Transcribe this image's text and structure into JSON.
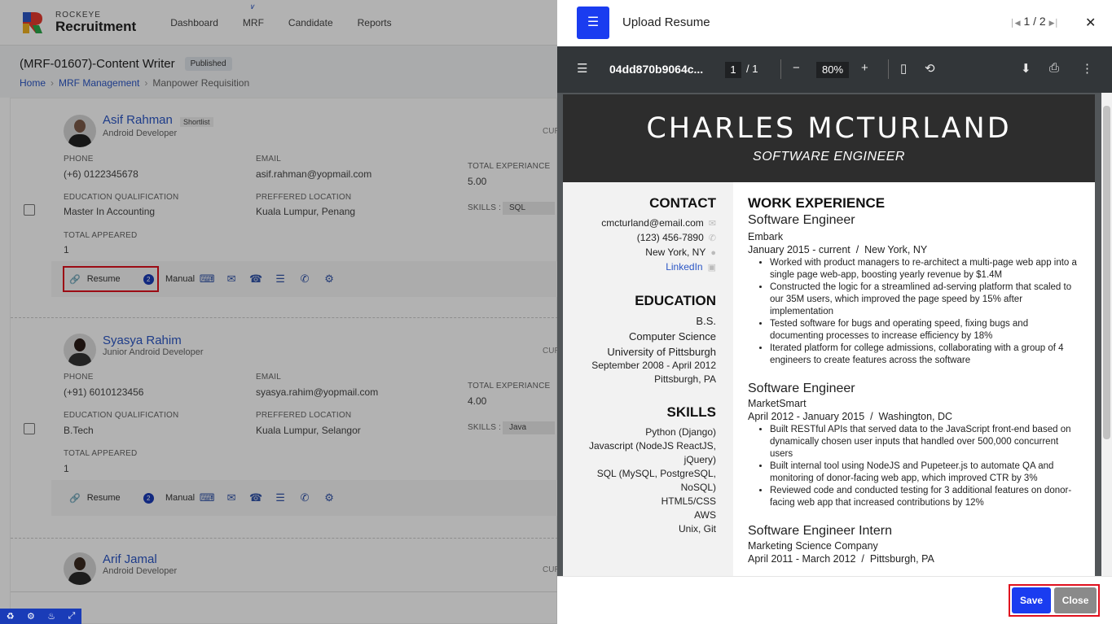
{
  "app": {
    "logo_small": "ROCKEYE",
    "logo_big": "Recruitment",
    "nav": [
      "Dashboard",
      "MRF",
      "Candidate",
      "Reports"
    ],
    "page_title": "(MRF-01607)-Content Writer",
    "status_badge": "Published",
    "breadcrumb": [
      "Home",
      "MRF Management",
      "Manpower Requisition"
    ]
  },
  "labels": {
    "phone": "PHONE",
    "email": "EMAIL",
    "total_exp": "TOTAL EXPERIANCE",
    "education": "EDUCATION QUALIFICATION",
    "location": "PREFFERED LOCATION",
    "skills": "SKILLS :",
    "appeared": "TOTAL APPEARED",
    "cur": "CUR",
    "resume": "Resume",
    "manual": "Manual"
  },
  "candidates": [
    {
      "name": "Asif Rahman",
      "tag": "Shortlist",
      "role": "Android Developer",
      "phone": "(+6) 0122345678",
      "email": "asif.rahman@yopmail.com",
      "experience": "5.00",
      "education": "Master In Accounting",
      "location": "Kuala Lumpur, Penang",
      "skill": "SQL",
      "appeared": "1",
      "resume_count": "2"
    },
    {
      "name": "Syasya Rahim",
      "tag": "",
      "role": "Junior Android Developer",
      "phone": "(+91) 6010123456",
      "email": "syasya.rahim@yopmail.com",
      "experience": "4.00",
      "education": "B.Tech",
      "location": "Kuala Lumpur, Selangor",
      "skill": "Java",
      "appeared": "1",
      "resume_count": "2"
    },
    {
      "name": "Arif Jamal",
      "tag": "",
      "role": "Android Developer"
    }
  ],
  "modal": {
    "title": "Upload Resume",
    "pager": "1 / 2",
    "file_name": "04dd870b9064c...",
    "page_current": "1",
    "page_total": "/ 1",
    "zoom": "80%",
    "save_label": "Save",
    "close_label": "Close"
  },
  "resume": {
    "name": "CHARLES MCTURLAND",
    "title": "SOFTWARE ENGINEER",
    "contact_heading": "CONTACT",
    "contact": [
      "cmcturland@email.com",
      "(123) 456-7890",
      "New York, NY",
      "LinkedIn"
    ],
    "education_heading": "EDUCATION",
    "education": [
      "B.S.",
      "Computer Science",
      "University of Pittsburgh",
      "September 2008 - April 2012",
      "Pittsburgh, PA"
    ],
    "skills_heading": "SKILLS",
    "skills": [
      "Python (Django)",
      "Javascript (NodeJS ReactJS,",
      "jQuery)",
      "SQL (MySQL, PostgreSQL,",
      "NoSQL)",
      "HTML5/CSS",
      "AWS",
      "Unix, Git"
    ],
    "work_heading": "WORK EXPERIENCE",
    "jobs": [
      {
        "title": "Software Engineer",
        "company": "Embark",
        "dates": "January 2015 - current  /  New York, NY",
        "bullets": [
          "Worked with product managers to re-architect a multi-page web app into a single page web-app, boosting yearly revenue by $1.4M",
          "Constructed the logic for a streamlined ad-serving platform that scaled to our 35M users, which improved the page speed by 15% after implementation",
          "Tested software for bugs and operating speed, fixing bugs and documenting processes to increase efficiency by 18%",
          "Iterated platform for college admissions, collaborating with a group of 4 engineers to create features across the software"
        ]
      },
      {
        "title": "Software Engineer",
        "company": "MarketSmart",
        "dates": "April 2012 - January 2015  /  Washington, DC",
        "bullets": [
          "Built RESTful APIs that served data to the JavaScript front-end based on dynamically chosen user inputs that handled over 500,000 concurrent users",
          "Built internal tool using NodeJS and Pupeteer.js to automate QA and monitoring of donor-facing web app, which improved CTR by 3%",
          "Reviewed code and conducted testing for 3 additional features on donor-facing web app that increased contributions by 12%"
        ]
      },
      {
        "title": "Software Engineer Intern",
        "company": "Marketing Science Company",
        "dates": "April 2011 - March 2012  /  Pittsburgh, PA",
        "bullets": []
      }
    ]
  }
}
